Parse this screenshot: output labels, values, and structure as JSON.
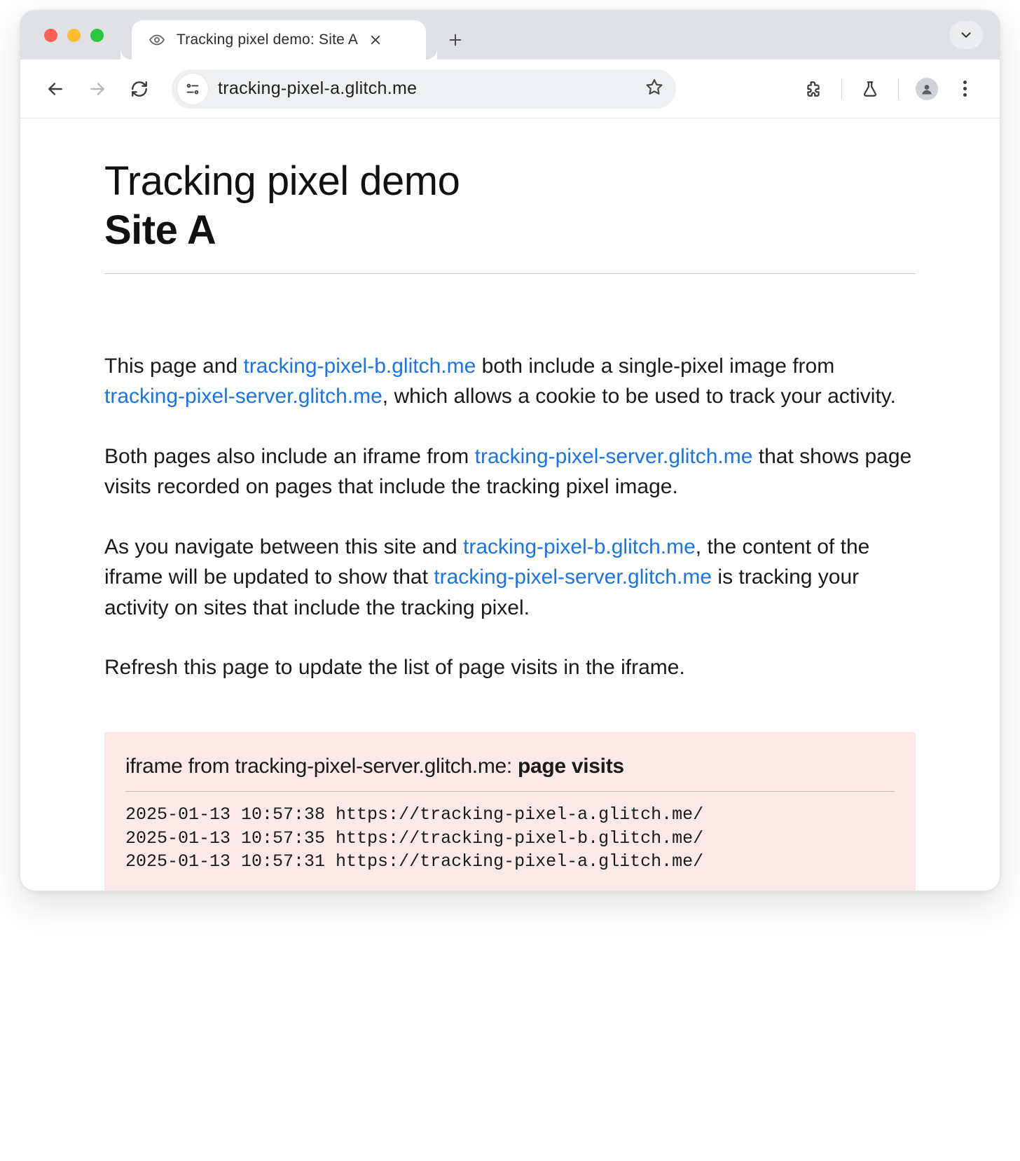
{
  "tabstrip": {
    "tab_title": "Tracking pixel demo: Site A"
  },
  "toolbar": {
    "url": "tracking-pixel-a.glitch.me"
  },
  "page": {
    "title_line1": "Tracking pixel demo",
    "title_line2": "Site A",
    "p1_a": "This page and ",
    "p1_link1": "tracking-pixel-b.glitch.me",
    "p1_b": " both include a single-pixel image from ",
    "p1_link2": "tracking-pixel-server.glitch.me",
    "p1_c": ", which allows a cookie to be used to track your activity.",
    "p2_a": "Both pages also include an iframe from ",
    "p2_link1": "tracking-pixel-server.glitch.me",
    "p2_b": " that shows page visits recorded on pages that include the tracking pixel image.",
    "p3_a": "As you navigate between this site and ",
    "p3_link1": "tracking-pixel-b.glitch.me",
    "p3_b": ", the content of the iframe will be updated to show that ",
    "p3_link2": "tracking-pixel-server.glitch.me",
    "p3_c": " is tracking your activity on sites that include the tracking pixel.",
    "p4": "Refresh this page to update the list of page visits in the iframe."
  },
  "iframe": {
    "title_a": "iframe from tracking-pixel-server.glitch.me: ",
    "title_b": "page visits",
    "log_entries": [
      {
        "ts": "2025-01-13 10:57:38",
        "url": "https://tracking-pixel-a.glitch.me/"
      },
      {
        "ts": "2025-01-13 10:57:35",
        "url": "https://tracking-pixel-b.glitch.me/"
      },
      {
        "ts": "2025-01-13 10:57:31",
        "url": "https://tracking-pixel-a.glitch.me/"
      }
    ]
  }
}
